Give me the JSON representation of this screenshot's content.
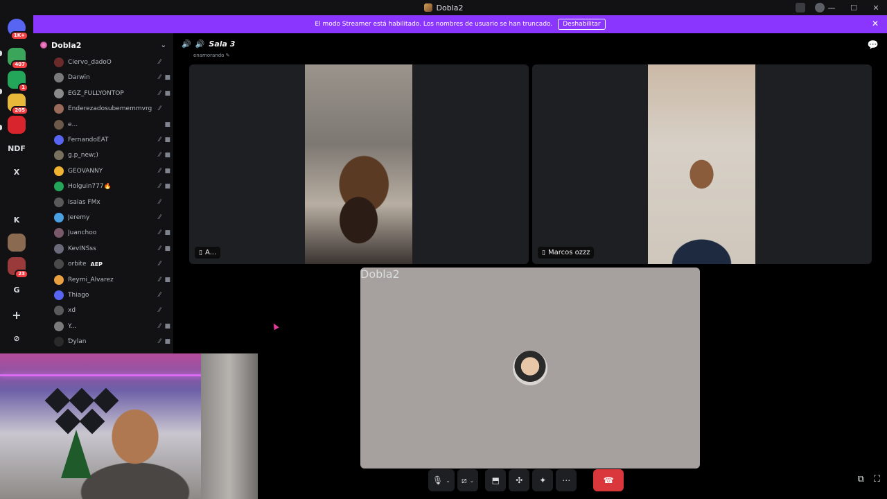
{
  "window": {
    "title": "Dobla2"
  },
  "banner": {
    "text": "El modo Streamer está habilitado. Los nombres de usuario se han truncado.",
    "button_label": "Deshabilitar"
  },
  "rail": {
    "servers": [
      {
        "label": "",
        "badge": "1K+",
        "color": "#5865f2"
      },
      {
        "label": "",
        "badge": "407",
        "color": "#3ba55c"
      },
      {
        "label": "",
        "badge": "1",
        "color": "#23a55a"
      },
      {
        "label": "",
        "badge": "205",
        "color": "#e8b83a"
      },
      {
        "label": "",
        "badge": "",
        "color": "#d8242c"
      },
      {
        "label": "NDF",
        "badge": "",
        "color": "#121214"
      },
      {
        "label": "X",
        "badge": "",
        "color": "#121214"
      },
      {
        "label": "",
        "badge": "",
        "color": "#121214"
      },
      {
        "label": "K",
        "badge": "",
        "color": "#121214"
      },
      {
        "label": "",
        "badge": "",
        "color": "#8a6a50"
      },
      {
        "label": "",
        "badge": "23",
        "color": "#9a3a3a"
      },
      {
        "label": "G",
        "badge": "",
        "color": "#121214"
      }
    ],
    "add_label": "+",
    "discover_label": "⊘"
  },
  "guild": {
    "name": "Dobla2"
  },
  "members": [
    {
      "name": "Ciervo_dadoO",
      "tag": "",
      "color": "#6b2b2b",
      "muted": true,
      "cam": false
    },
    {
      "name": "Darwin",
      "tag": "",
      "color": "#7a7a7a",
      "muted": true,
      "cam": true
    },
    {
      "name": "EGZ_FULLYONTOP",
      "tag": "",
      "color": "#8a8a8a",
      "muted": true,
      "cam": true
    },
    {
      "name": "Enderezadosubememmvrg",
      "tag": "",
      "color": "#9a6a5a",
      "muted": true,
      "cam": false
    },
    {
      "name": "e...",
      "tag": "",
      "color": "#6b5a4a",
      "muted": false,
      "cam": true
    },
    {
      "name": "FernandoEAT",
      "tag": "",
      "color": "#5865f2",
      "muted": true,
      "cam": true
    },
    {
      "name": "g.p_new;)",
      "tag": "",
      "color": "#7a7060",
      "muted": true,
      "cam": true
    },
    {
      "name": "GEOVANNY",
      "tag": "",
      "color": "#f0b232",
      "muted": true,
      "cam": true
    },
    {
      "name": "Holguin777🔥",
      "tag": "",
      "color": "#23a55a",
      "muted": true,
      "cam": true
    },
    {
      "name": "Isaias FMx",
      "tag": "",
      "color": "#5a5a5a",
      "muted": true,
      "cam": false
    },
    {
      "name": "Jeremy",
      "tag": "",
      "color": "#4aa0e0",
      "muted": true,
      "cam": false
    },
    {
      "name": "Juanchoo",
      "tag": "",
      "color": "#7a5a6a",
      "muted": true,
      "cam": true
    },
    {
      "name": "KevINSss",
      "tag": "",
      "color": "#6a6a7a",
      "muted": true,
      "cam": true
    },
    {
      "name": "orbite",
      "tag": "AEP",
      "color": "#4a4a4a",
      "muted": true,
      "cam": false
    },
    {
      "name": "Reymi_Alvarez",
      "tag": "",
      "color": "#e8a040",
      "muted": true,
      "cam": true
    },
    {
      "name": "Thiago",
      "tag": "",
      "color": "#5865f2",
      "muted": true,
      "cam": false
    },
    {
      "name": "xd",
      "tag": "",
      "color": "#5a5a5a",
      "muted": true,
      "cam": false
    },
    {
      "name": "Y...",
      "tag": "",
      "color": "#7a7a7a",
      "muted": true,
      "cam": true
    },
    {
      "name": "Ɗylan",
      "tag": "",
      "color": "#2a2a2a",
      "muted": true,
      "cam": true
    }
  ],
  "call": {
    "channel": "Sala 3",
    "subtitle": "enamorando",
    "tiles": [
      {
        "label": "A..."
      },
      {
        "label": "Marcos ozzz"
      }
    ],
    "self_label": "Dobla2"
  },
  "icons": {
    "phone": "📱",
    "mic": "🎤",
    "camera_off": "⊘",
    "screen": "🖥",
    "activities": "✣",
    "soundboard": "✋",
    "more": "⋯",
    "hangup": "☎",
    "popout": "⧉",
    "fullscreen": "⛶",
    "chat": "💬"
  }
}
